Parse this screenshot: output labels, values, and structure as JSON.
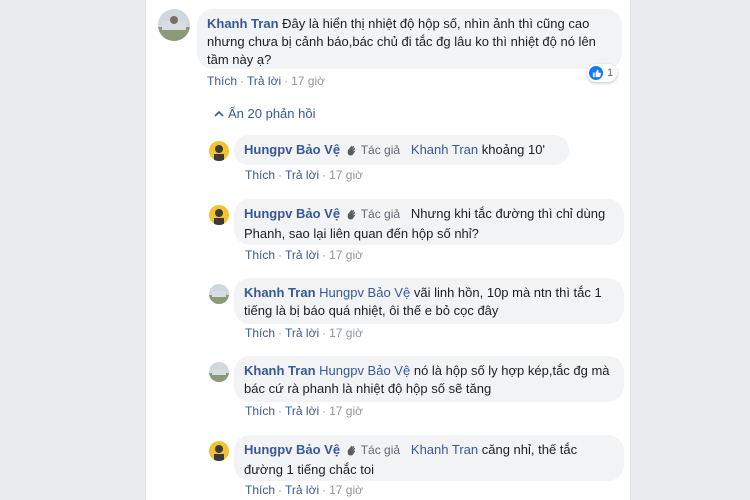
{
  "main_comment": {
    "name": "Khanh Tran",
    "text": "Đây là hiển thị nhiệt độ hộp số, nhìn ảnh thì cũng cao nhưng chưa bị cảnh báo,bác chủ đi tắc đg lâu ko thì nhiệt độ nó lên tầm này ạ?",
    "like": "Thích",
    "reply": "Trả lời",
    "time": "17 giờ",
    "reaction_count": "1"
  },
  "hide_replies": "Ẩn 20 phản hồi",
  "replies": [
    {
      "name": "Hungpv Bảo Vệ",
      "author_tag": "Tác giả",
      "mention": "Khanh Tran",
      "text": "khoảng 10'",
      "like": "Thích",
      "reply": "Trả lời",
      "time": "17 giờ"
    },
    {
      "name": "Hungpv Bảo Vệ",
      "author_tag": "Tác giả",
      "mention": "",
      "text": "Nhưng khi tắc đường thì chỉ dùng Phanh, sao lại liên quan đến hộp số nhỉ?",
      "like": "Thích",
      "reply": "Trả lời",
      "time": "17 giờ"
    },
    {
      "name": "Khanh Tran",
      "author_tag": "",
      "mention": "Hungpv Bảo Vệ",
      "text": "vãi linh hồn, 10p mà ntn thì tắc 1 tiếng là bị báo quá nhiệt, ôi thế e bỏ cọc đây",
      "like": "Thích",
      "reply": "Trả lời",
      "time": "17 giờ"
    },
    {
      "name": "Khanh Tran",
      "author_tag": "",
      "mention": "Hungpv Bảo Vệ",
      "text": "nó là hộp số ly hợp kép,tắc đg mà bác cứ rà phanh là nhiệt độ hộp số sẽ tăng",
      "like": "Thích",
      "reply": "Trả lời",
      "time": "17 giờ"
    },
    {
      "name": "Hungpv Bảo Vệ",
      "author_tag": "Tác giả",
      "mention": "Khanh Tran",
      "text": "căng nhỉ, thế tắc đường 1 tiếng chắc toi",
      "like": "Thích",
      "reply": "Trả lời",
      "time": "17 giờ"
    }
  ],
  "colors": {
    "link": "#385898",
    "bubble": "#f2f3f5",
    "meta": "#90949c",
    "like_blue": "#1877f2"
  }
}
